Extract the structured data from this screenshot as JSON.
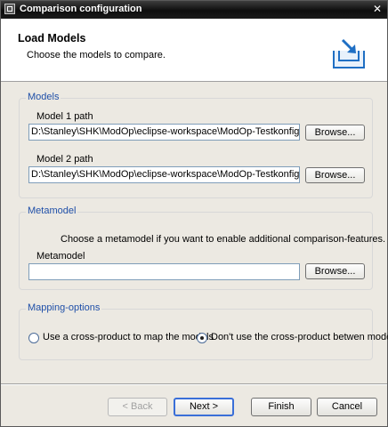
{
  "window": {
    "title": "Comparison configuration",
    "close_glyph": "✕"
  },
  "header": {
    "title": "Load Models",
    "description": "Choose the models to compare."
  },
  "models": {
    "legend": "Models",
    "model1": {
      "label": "Model 1 path",
      "value": "D:\\Stanley\\SHK\\ModOp\\eclipse-workspace\\ModOp-Testkonfiguration\\",
      "browse": "Browse..."
    },
    "model2": {
      "label": "Model 2 path",
      "value": "D:\\Stanley\\SHK\\ModOp\\eclipse-workspace\\ModOp-Testkonfiguration\\",
      "browse": "Browse..."
    }
  },
  "metamodel": {
    "legend": "Metamodel",
    "hint": "Choose a metamodel if you want to enable additional comparison-features.",
    "label": "Metamodel",
    "value": "",
    "browse": "Browse..."
  },
  "mapping": {
    "legend": "Mapping-options",
    "options": [
      {
        "label": "Use a cross-product to map the models",
        "selected": false
      },
      {
        "label": "Don't use the cross-product betwen models",
        "selected": true
      }
    ]
  },
  "footer": {
    "back": "< Back",
    "next": "Next >",
    "finish": "Finish",
    "cancel": "Cancel"
  },
  "icons": {
    "window_icon": "app-window-icon",
    "wizard": "import-tray-icon"
  },
  "colors": {
    "legend_text": "#1f4fa8",
    "title_bar": "#1a1a1a",
    "icon_blue": "#1f6fc4"
  }
}
